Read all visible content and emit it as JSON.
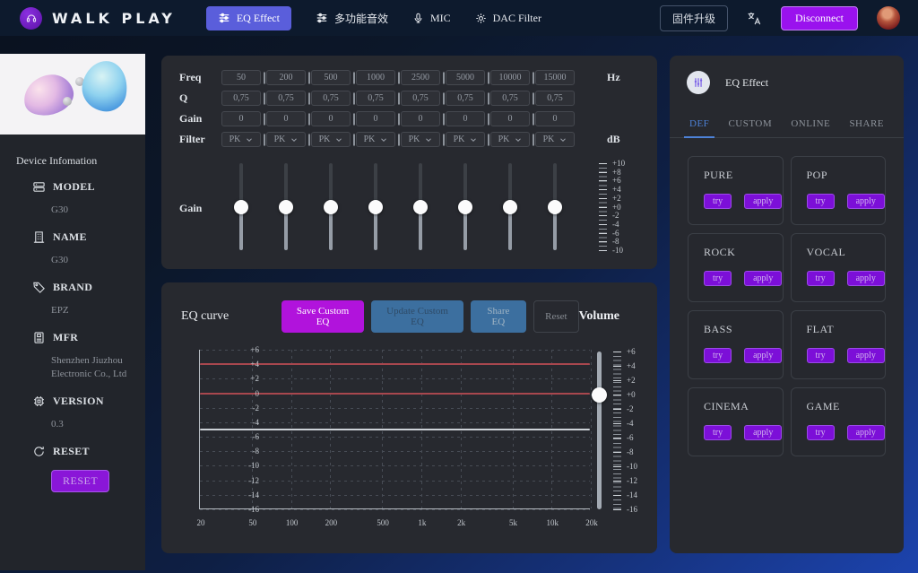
{
  "navbar": {
    "logo_text": "WALK PLAY",
    "tabs": [
      {
        "key": "eq-effect",
        "label": "EQ Effect",
        "icon": "equalizer-icon",
        "active": true
      },
      {
        "key": "sound-effects",
        "label": "多功能音效",
        "icon": "equalizer-icon",
        "active": false
      },
      {
        "key": "mic",
        "label": "MIC",
        "icon": "mic-icon",
        "active": false
      },
      {
        "key": "dac-filter",
        "label": "DAC Filter",
        "icon": "gear-icon",
        "active": false
      }
    ],
    "firmware_button": "固件升级",
    "disconnect_button": "Disconnect"
  },
  "sidebar": {
    "section_title": "Device Infomation",
    "items": [
      {
        "key": "model",
        "label": "MODEL",
        "value": "G30",
        "icon": "model-icon"
      },
      {
        "key": "name",
        "label": "NAME",
        "value": "G30",
        "icon": "building-icon"
      },
      {
        "key": "brand",
        "label": "BRAND",
        "value": "EPZ",
        "icon": "tag-icon"
      },
      {
        "key": "mfr",
        "label": "MFR",
        "value": "Shenzhen Jiuzhou Electronic Co., Ltd",
        "icon": "card-icon"
      },
      {
        "key": "version",
        "label": "VERSION",
        "value": "0.3",
        "icon": "chip-icon"
      },
      {
        "key": "reset",
        "label": "RESET",
        "value": "",
        "icon": "refresh-icon",
        "button": "RESET"
      }
    ]
  },
  "eq_panel": {
    "row_labels": {
      "freq": "Freq",
      "q": "Q",
      "gain": "Gain",
      "filter": "Filter"
    },
    "slider_label": "Gain",
    "units": {
      "freq": "Hz",
      "filter": "dB"
    },
    "bands": [
      {
        "freq": "50",
        "q": "0,75",
        "gain": "0",
        "filter": "PK",
        "slider_db": 0
      },
      {
        "freq": "200",
        "q": "0,75",
        "gain": "0",
        "filter": "PK",
        "slider_db": 0
      },
      {
        "freq": "500",
        "q": "0,75",
        "gain": "0",
        "filter": "PK",
        "slider_db": 0
      },
      {
        "freq": "1000",
        "q": "0,75",
        "gain": "0",
        "filter": "PK",
        "slider_db": 0
      },
      {
        "freq": "2500",
        "q": "0,75",
        "gain": "0",
        "filter": "PK",
        "slider_db": 0
      },
      {
        "freq": "5000",
        "q": "0,75",
        "gain": "0",
        "filter": "PK",
        "slider_db": 0
      },
      {
        "freq": "10000",
        "q": "0,75",
        "gain": "0",
        "filter": "PK",
        "slider_db": 0
      },
      {
        "freq": "15000",
        "q": "0,75",
        "gain": "0",
        "filter": "PK",
        "slider_db": 0
      }
    ],
    "gain_scale": {
      "labels": [
        "+10",
        "+8",
        "+6",
        "+4",
        "+2",
        "+0",
        "-2",
        "-4",
        "-6",
        "-8",
        "-10"
      ],
      "max": 10,
      "min": -10
    }
  },
  "curve_panel": {
    "title": "EQ curve",
    "buttons": [
      {
        "key": "save-custom-eq",
        "label": "Save Custom EQ"
      },
      {
        "key": "update-custom-eq",
        "label": "Update Custom EQ"
      },
      {
        "key": "share-eq",
        "label": "Share EQ"
      },
      {
        "key": "reset-eq",
        "label": "Reset"
      }
    ],
    "volume_label": "Volume"
  },
  "chart_data": {
    "type": "line",
    "title": "EQ curve",
    "x_scale": "log",
    "x_ticks": [
      {
        "hz": 20,
        "label": "20"
      },
      {
        "hz": 50,
        "label": "50"
      },
      {
        "hz": 100,
        "label": "100"
      },
      {
        "hz": 200,
        "label": "200"
      },
      {
        "hz": 500,
        "label": "500"
      },
      {
        "hz": 1000,
        "label": "1k"
      },
      {
        "hz": 2000,
        "label": "2k"
      },
      {
        "hz": 5000,
        "label": "5k"
      },
      {
        "hz": 10000,
        "label": "10k"
      },
      {
        "hz": 20000,
        "label": "20k"
      }
    ],
    "ylim": [
      -16,
      6
    ],
    "y_ticks": [
      "+6",
      "+4",
      "+2",
      "0",
      "-2",
      "-4",
      "-6",
      "-8",
      "-10",
      "-12",
      "-14",
      "-16"
    ],
    "grid": true,
    "series": [
      {
        "name": "upper-red-line",
        "color": "#a8474e",
        "y_db": 4,
        "shape": "flat"
      },
      {
        "name": "zero-red-line",
        "color": "#a8474e",
        "y_db": 0,
        "shape": "flat"
      },
      {
        "name": "white-ref-line",
        "color": "#ccd1d7",
        "y_db": -5,
        "shape": "flat"
      }
    ],
    "volume_slider": {
      "value_db": 0,
      "max": 6,
      "min": -16,
      "scale_labels": [
        "+6",
        "+4",
        "+2",
        "+0",
        "-2",
        "-4",
        "-6",
        "-8",
        "-10",
        "-12",
        "-14",
        "-16"
      ]
    }
  },
  "presets_panel": {
    "title": "EQ Effect",
    "tabs": [
      {
        "key": "def",
        "label": "DEF",
        "active": true
      },
      {
        "key": "custom",
        "label": "CUSTOM",
        "active": false
      },
      {
        "key": "online",
        "label": "ONLINE",
        "active": false
      },
      {
        "key": "share",
        "label": "SHARE",
        "active": false
      }
    ],
    "try_label": "try",
    "apply_label": "apply",
    "presets": [
      "PURE",
      "POP",
      "ROCK",
      "VOCAL",
      "BASS",
      "FLAT",
      "CINEMA",
      "GAME"
    ]
  },
  "colors": {
    "accent_purple": "#9a12ee",
    "active_tab": "#5a5edb",
    "save_magenta": "#b113dc",
    "steel_blue": "#3c6f9f",
    "tab_blue": "#4d82d8",
    "preset_purple": "#7c0fd8",
    "panel_bg": "#27292f",
    "red_line": "#a8474e"
  }
}
